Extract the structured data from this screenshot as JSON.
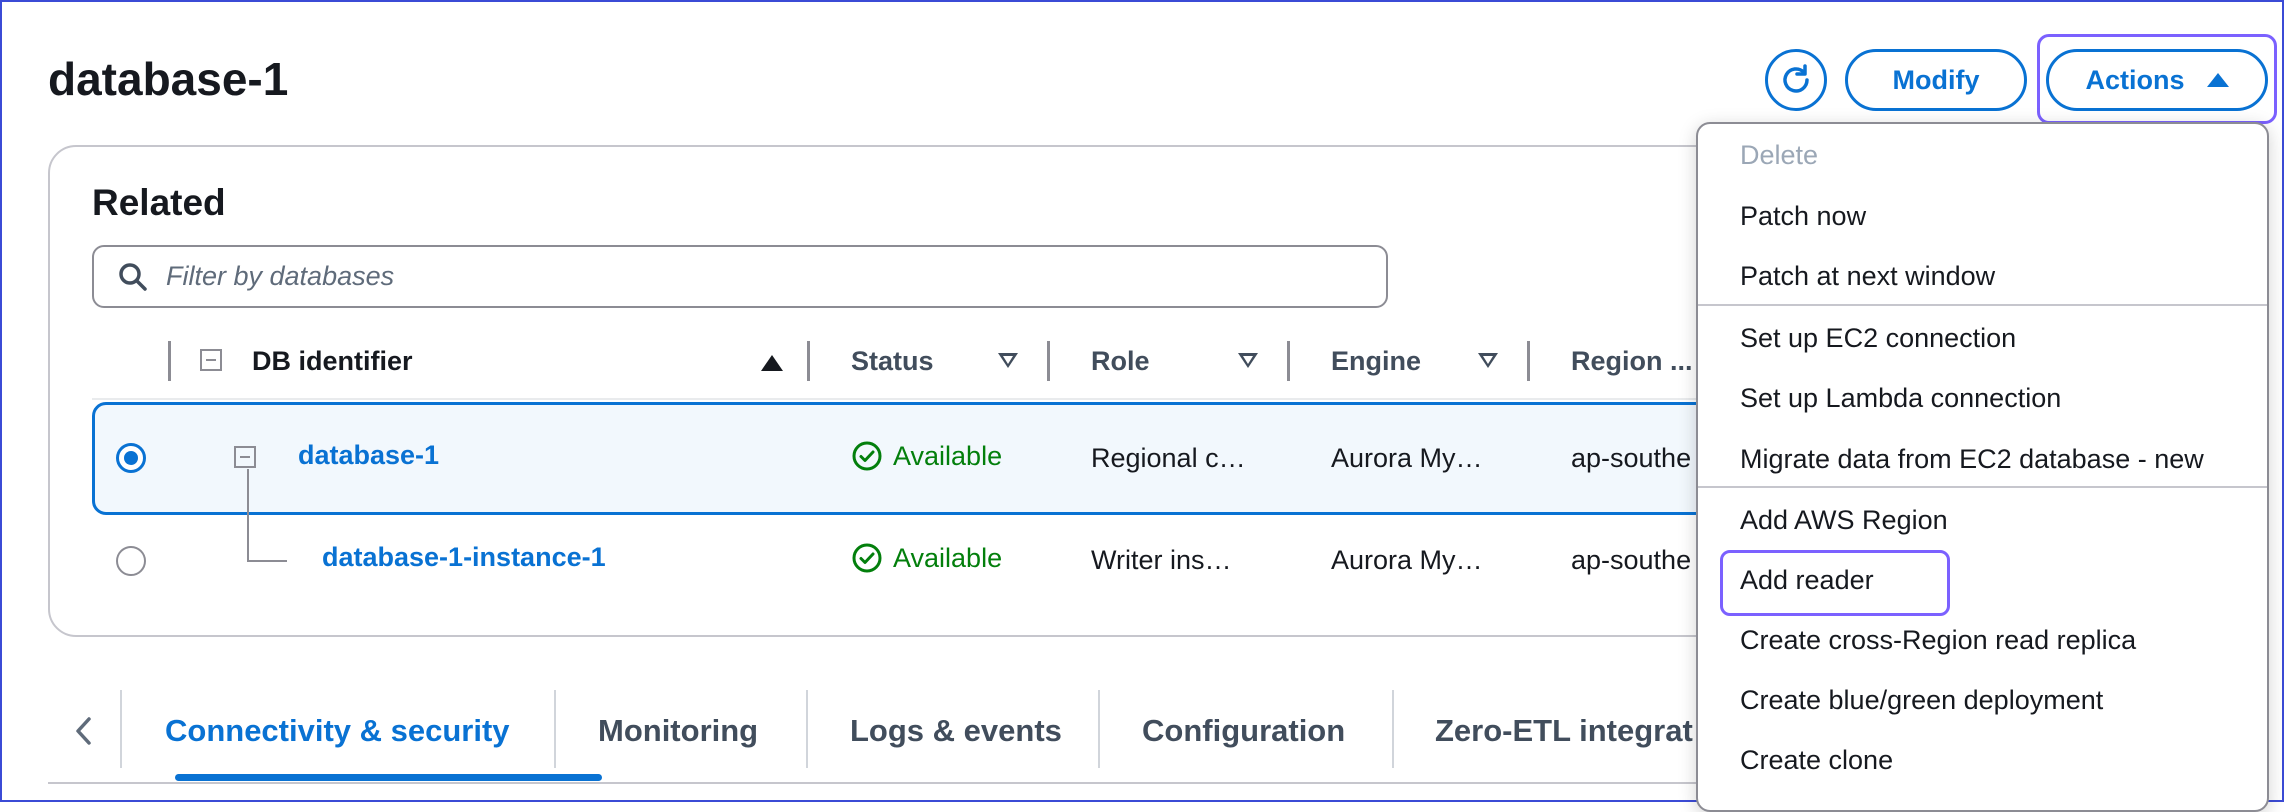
{
  "header": {
    "title": "database-1",
    "modify_label": "Modify",
    "actions_label": "Actions"
  },
  "related": {
    "title": "Related",
    "filter_placeholder": "Filter by databases",
    "columns": [
      "DB identifier",
      "Status",
      "Role",
      "Engine",
      "Region ..."
    ],
    "rows": [
      {
        "id": "database-1",
        "status": "Available",
        "role": "Regional c…",
        "engine": "Aurora My…",
        "region": "ap-southe",
        "selected": true
      },
      {
        "id": "database-1-instance-1",
        "status": "Available",
        "role": "Writer ins…",
        "engine": "Aurora My…",
        "region": "ap-southe",
        "selected": false
      }
    ]
  },
  "tabs": [
    "Connectivity & security",
    "Monitoring",
    "Logs & events",
    "Configuration",
    "Zero-ETL integrat"
  ],
  "actions_menu": {
    "items": [
      {
        "label": "Delete",
        "disabled": true
      },
      {
        "label": "Patch now"
      },
      {
        "label": "Patch at next window"
      },
      {
        "label": "Set up EC2 connection"
      },
      {
        "label": "Set up Lambda connection"
      },
      {
        "label": "Migrate data from EC2 database - new"
      },
      {
        "label": "Add AWS Region"
      },
      {
        "label": "Add reader"
      },
      {
        "label": "Create cross-Region read replica"
      },
      {
        "label": "Create blue/green deployment"
      },
      {
        "label": "Create clone"
      }
    ]
  },
  "colors": {
    "accent": "#0972d3",
    "success": "#037f0c",
    "focus_ring": "#7b61ff"
  }
}
